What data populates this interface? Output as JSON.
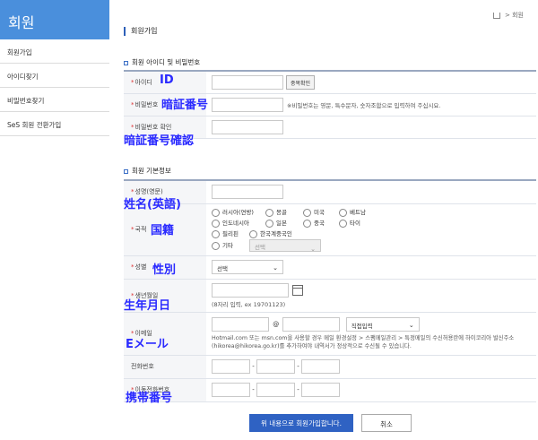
{
  "sidebar": {
    "title": "회원",
    "items": [
      {
        "label": "회원가입"
      },
      {
        "label": "아이디찾기"
      },
      {
        "label": "비밀번호찾기"
      },
      {
        "label": "SeS 회원 전환가입"
      }
    ]
  },
  "breadcrumb": {
    "separator": ">",
    "current": "회원"
  },
  "page_title": "회원가입",
  "section1": {
    "title": "회원 아이디 및 비밀번호",
    "rows": {
      "id_label": "아이디",
      "id_check_button": "중복확인",
      "id_annotation": "ID",
      "pw_label": "비밀번호",
      "pw_hint": "※비밀번호는 영문, 특수문자, 숫자조합으로 입력하여 주십시요.",
      "pw_annotation": "暗証番号",
      "pw_confirm_label": "비밀번호 확인",
      "pw_confirm_annotation": "暗証番号確認"
    }
  },
  "section2": {
    "title": "회원 기본정보",
    "name_label": "성명(영문)",
    "name_annotation": "姓名(英語)",
    "nationality_label": "국적",
    "nationality_annotation": "国籍",
    "nationality_options": [
      "러시아(연방)",
      "몽골",
      "미국",
      "베트남",
      "인도네시아",
      "일본",
      "중국",
      "타이",
      "필리핀",
      "한국계중국인",
      "기타"
    ],
    "nationality_other_select": "선택",
    "gender_label": "성별",
    "gender_annotation": "性別",
    "gender_select": "선택",
    "birth_label": "생년월일",
    "birth_annotation": "生年月日",
    "birth_hint": "(8자리 입력, ex 19701123)",
    "email_label": "이메일",
    "email_annotation": "Eメール",
    "email_at": "@",
    "email_domain_select": "직접입력",
    "email_notice": "Hotmail.com 또는 msn.com을 사용할 경우 메일 환경설정 > 스팸메일관리 > 특정메일의 수신허용란에 하이코리아 발신주소(hikorea@hikorea.go.kr)를 추가하여야 내역서가 정상적으로 수신될 수 있습니다.",
    "phone_label": "전화번호",
    "mobile_label": "이동전화번호",
    "mobile_annotation": "携帯番号",
    "dash": "-"
  },
  "actions": {
    "submit": "위 내용으로 회원가입합니다.",
    "cancel": "취소"
  },
  "colors": {
    "accent": "#2f62c3",
    "sidebar_header": "#4a8fdc",
    "annotation": "#2a2aff"
  }
}
